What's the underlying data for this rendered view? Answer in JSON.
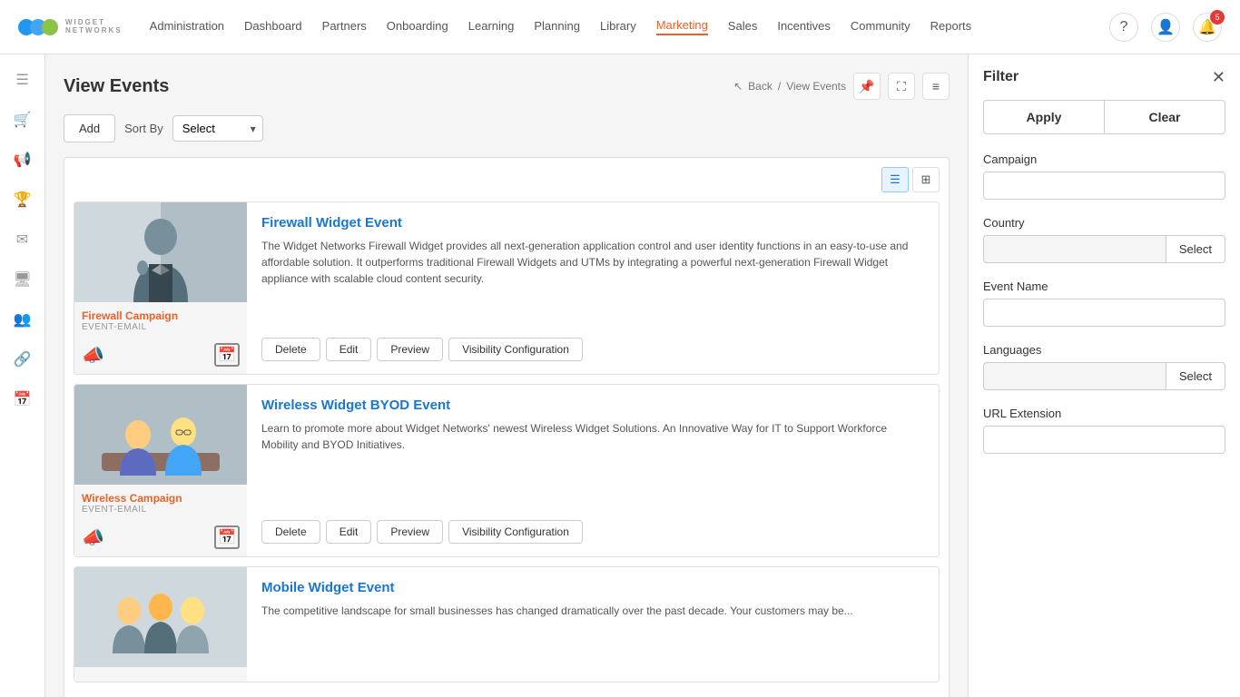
{
  "logo": {
    "brand": "WIDGET",
    "tagline": "NETWORKS"
  },
  "nav": {
    "links": [
      {
        "label": "Administration",
        "active": false
      },
      {
        "label": "Dashboard",
        "active": false
      },
      {
        "label": "Partners",
        "active": false
      },
      {
        "label": "Onboarding",
        "active": false
      },
      {
        "label": "Learning",
        "active": false
      },
      {
        "label": "Planning",
        "active": false
      },
      {
        "label": "Library",
        "active": false
      },
      {
        "label": "Marketing",
        "active": true
      },
      {
        "label": "Sales",
        "active": false
      },
      {
        "label": "Incentives",
        "active": false
      },
      {
        "label": "Community",
        "active": false
      },
      {
        "label": "Reports",
        "active": false
      }
    ],
    "notification_count": "5"
  },
  "sidebar": {
    "icons": [
      {
        "name": "menu-icon",
        "symbol": "☰"
      },
      {
        "name": "cart-icon",
        "symbol": "🛒"
      },
      {
        "name": "megaphone-icon",
        "symbol": "📢"
      },
      {
        "name": "trophy-icon",
        "symbol": "🏆"
      },
      {
        "name": "email-icon",
        "symbol": "✉"
      },
      {
        "name": "monitor-icon",
        "symbol": "🖥"
      },
      {
        "name": "group-icon",
        "symbol": "👥"
      },
      {
        "name": "link-icon",
        "symbol": "🔗"
      },
      {
        "name": "calendar-icon",
        "symbol": "📅"
      }
    ]
  },
  "page": {
    "title": "View Events",
    "breadcrumb_back": "Back",
    "breadcrumb_current": "View Events"
  },
  "toolbar": {
    "add_label": "Add",
    "sort_label": "Sort By",
    "sort_value": "Select"
  },
  "events": [
    {
      "id": 1,
      "name": "Firewall Widget Event",
      "campaign": "Firewall Campaign",
      "event_type": "EVENT-EMAIL",
      "description": "The Widget Networks Firewall Widget provides all next-generation application control and user identity functions in an easy-to-use and affordable solution. It outperforms traditional Firewall Widgets and UTMs by integrating a powerful next-generation Firewall Widget appliance with scalable cloud content security.",
      "thumb_class": "thumb-person",
      "icon_left": "📣",
      "icon_right": "📅",
      "campaign_color": "#e8622a",
      "actions": [
        "Delete",
        "Edit",
        "Preview",
        "Visibility Configuration"
      ]
    },
    {
      "id": 2,
      "name": "Wireless Widget BYOD Event",
      "campaign": "Wireless Campaign",
      "event_type": "EVENT-EMAIL",
      "description": "Learn to promote more about Widget Networks' newest Wireless Widget Solutions. An Innovative Way for IT to Support Workforce Mobility and BYOD Initiatives.",
      "thumb_class": "thumb-person thumb-person-2",
      "icon_left": "📣",
      "icon_right": "📅",
      "campaign_color": "#e8622a",
      "actions": [
        "Delete",
        "Edit",
        "Preview",
        "Visibility Configuration"
      ]
    },
    {
      "id": 3,
      "name": "Mobile Widget Event",
      "campaign": "",
      "event_type": "",
      "description": "The competitive landscape for small businesses has changed dramatically over the past decade. Your customers may be...",
      "thumb_class": "thumb-person thumb-person-3",
      "icon_left": "",
      "icon_right": "",
      "campaign_color": "#e8622a",
      "actions": []
    }
  ],
  "filter": {
    "title": "Filter",
    "apply_label": "Apply",
    "clear_label": "Clear",
    "fields": [
      {
        "label": "Campaign",
        "type": "text",
        "value": "",
        "placeholder": ""
      },
      {
        "label": "Country",
        "type": "select",
        "value": "",
        "placeholder": ""
      },
      {
        "label": "Event Name",
        "type": "text",
        "value": "",
        "placeholder": ""
      },
      {
        "label": "Languages",
        "type": "select",
        "value": "",
        "placeholder": ""
      },
      {
        "label": "URL Extension",
        "type": "text",
        "value": "",
        "placeholder": ""
      }
    ],
    "select_label": "Select"
  }
}
